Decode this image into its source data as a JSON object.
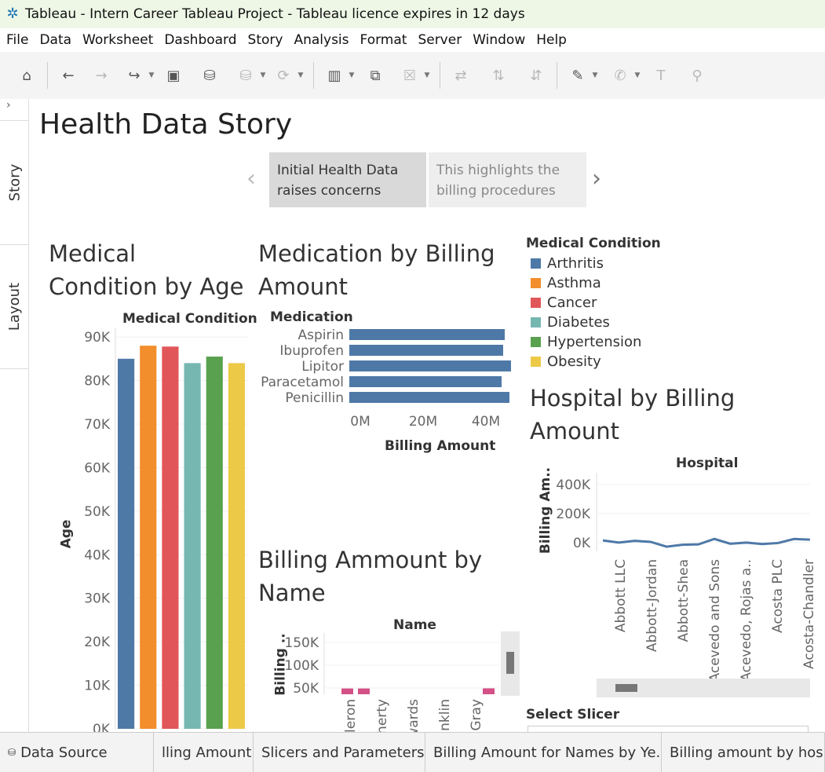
{
  "window": {
    "title": "Tableau - Intern Career Tableau Project - Tableau licence expires in 12 days"
  },
  "menu": [
    "File",
    "Data",
    "Worksheet",
    "Dashboard",
    "Story",
    "Analysis",
    "Format",
    "Server",
    "Window",
    "Help"
  ],
  "toolbar_icons": [
    "home-icon",
    "back-icon",
    "forward-icon",
    "redo-icon",
    "save-icon",
    "new-datasource-icon",
    "datasource-icon",
    "refresh-icon",
    "new-worksheet-icon",
    "duplicate-icon",
    "clear-icon",
    "swap-icon",
    "sort-asc-icon",
    "sort-desc-icon",
    "highlight-icon",
    "attach-icon",
    "text-icon",
    "pin-icon"
  ],
  "sidebar": {
    "tabs": [
      "Story",
      "Layout"
    ]
  },
  "story": {
    "title": "Health Data Story",
    "points": [
      {
        "label": "Initial Health Data raises  concerns"
      },
      {
        "label": "This highlights the billing procedures"
      }
    ]
  },
  "colors": {
    "Arthritis": "#4e79a7",
    "Asthma": "#f28e2b",
    "Cancer": "#e15759",
    "Diabetes": "#76b7b2",
    "Hypertension": "#59a14f",
    "Obesity": "#edc948",
    "medication_bar": "#4e79a7",
    "name_bar": "#d45087"
  },
  "sheets": {
    "condition_age": {
      "title": "Medical Condition by Age",
      "header": "Medical Condition",
      "ylabel": "Age"
    },
    "medication": {
      "title": "Medication by Billing Amount",
      "header": "Medication",
      "xlabel": "Billing Amount"
    },
    "hospital": {
      "title": "Hospital by Billing Amount",
      "header": "Hospital",
      "ylabel": "Billing Am.."
    },
    "name": {
      "title": "Billing Ammount by Name",
      "header": "Name",
      "ylabel": "Billing .."
    }
  },
  "legend": {
    "title": "Medical Condition",
    "items": [
      "Arthritis",
      "Asthma",
      "Cancer",
      "Diabetes",
      "Hypertension",
      "Obesity"
    ]
  },
  "slicer": {
    "label": "Select Slicer"
  },
  "bottom_tabs": [
    "Data Source",
    "lling Amount",
    "Slicers and Parameters",
    "Billing Amount for Names by Ye...",
    "Billing amount by hospit"
  ],
  "chart_data": [
    {
      "type": "bar",
      "title": "Medical Condition by Age",
      "xlabel": "Medical Condition",
      "ylabel": "Age",
      "categories": [
        "Arthritis",
        "Asthma",
        "Cancer",
        "Diabetes",
        "Hypertension",
        "Obesity"
      ],
      "values": [
        85000,
        88000,
        87800,
        84000,
        85500,
        84000
      ],
      "ylim": [
        0,
        92000
      ],
      "yticks": [
        "0K",
        "10K",
        "20K",
        "30K",
        "40K",
        "50K",
        "60K",
        "70K",
        "80K",
        "90K"
      ]
    },
    {
      "type": "bar",
      "orientation": "horizontal",
      "title": "Medication by Billing Amount",
      "ylabel": "Medication",
      "xlabel": "Billing Amount",
      "categories": [
        "Aspirin",
        "Ibuprofen",
        "Lipitor",
        "Paracetamol",
        "Penicillin"
      ],
      "values": [
        49500000,
        49000000,
        51500000,
        48500000,
        51000000
      ],
      "xticks": [
        "0M",
        "20M",
        "40M"
      ]
    },
    {
      "type": "line",
      "title": "Hospital by Billing Amount",
      "xlabel": "Hospital",
      "ylabel": "Billing Am..",
      "x": [
        "Abbott LLC",
        "Abbott-Jordan",
        "Abbott-Shea",
        "Acevedo and Sons",
        "Acevedo, Rojas a..",
        "Acosta PLC",
        "Acosta-Chandler"
      ],
      "values": [
        15000,
        0,
        12000,
        5000,
        -28000,
        -15000,
        -12000,
        25000,
        -8000,
        0,
        -10000,
        -3000,
        25000,
        20000
      ],
      "yticks": [
        "0K",
        "200K",
        "400K"
      ],
      "ylim": [
        -60000,
        480000
      ]
    },
    {
      "type": "bar",
      "title": "Billing Ammount by Name",
      "xlabel": "Name",
      "ylabel": "Billing ..",
      "categories": [
        "..leron",
        "..herty",
        "..wards",
        "..nklin",
        "Gray"
      ],
      "values": [
        46000,
        46000,
        0,
        0,
        47000
      ],
      "yticks": [
        "50K",
        "100K",
        "150K"
      ]
    }
  ]
}
